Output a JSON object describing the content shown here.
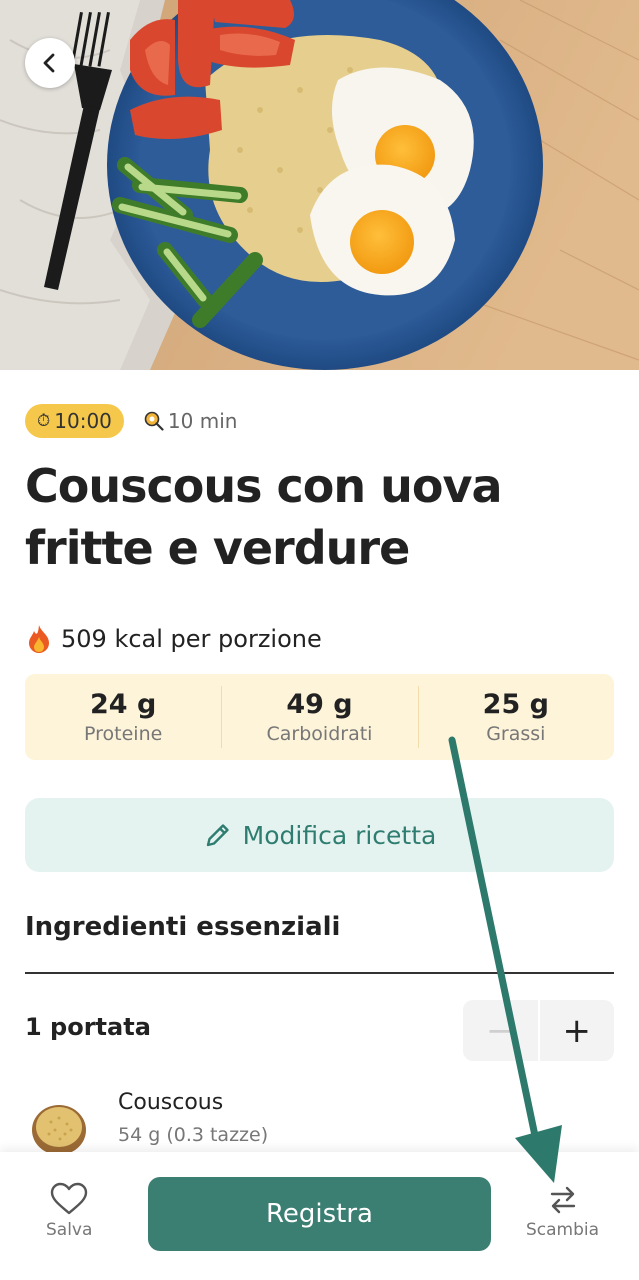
{
  "hero": {
    "image_alt": "Couscous con uova fritte e verdure"
  },
  "meta": {
    "time_badge": "10:00",
    "time_icon": "stopwatch-icon",
    "duration": "10 min",
    "duration_icon": "frying-pan-icon"
  },
  "recipe": {
    "title": "Couscous con uova fritte e verdure",
    "kcal_text": "509 kcal per porzione",
    "kcal_icon": "fire-icon"
  },
  "macros": [
    {
      "value": "24 g",
      "label": "Proteine"
    },
    {
      "value": "49 g",
      "label": "Carboidrati"
    },
    {
      "value": "25 g",
      "label": "Grassi"
    }
  ],
  "edit": {
    "label": "Modifica ricetta"
  },
  "ingredients": {
    "section_title": "Ingredienti essenziali",
    "portions_label": "1 portata",
    "stepper": {
      "minus": "−",
      "plus": "+"
    },
    "items": [
      {
        "name": "Couscous",
        "quantity": "54 g (0.3 tazze)"
      }
    ]
  },
  "bottom_bar": {
    "save_label": "Salva",
    "log_label": "Registra",
    "swap_label": "Scambia"
  },
  "colors": {
    "accent": "#3a7f72",
    "accent_text": "#2f7d70",
    "edit_bg": "#e5f3f0",
    "macro_bg": "#fdf4da",
    "badge": "#f5c84b"
  }
}
